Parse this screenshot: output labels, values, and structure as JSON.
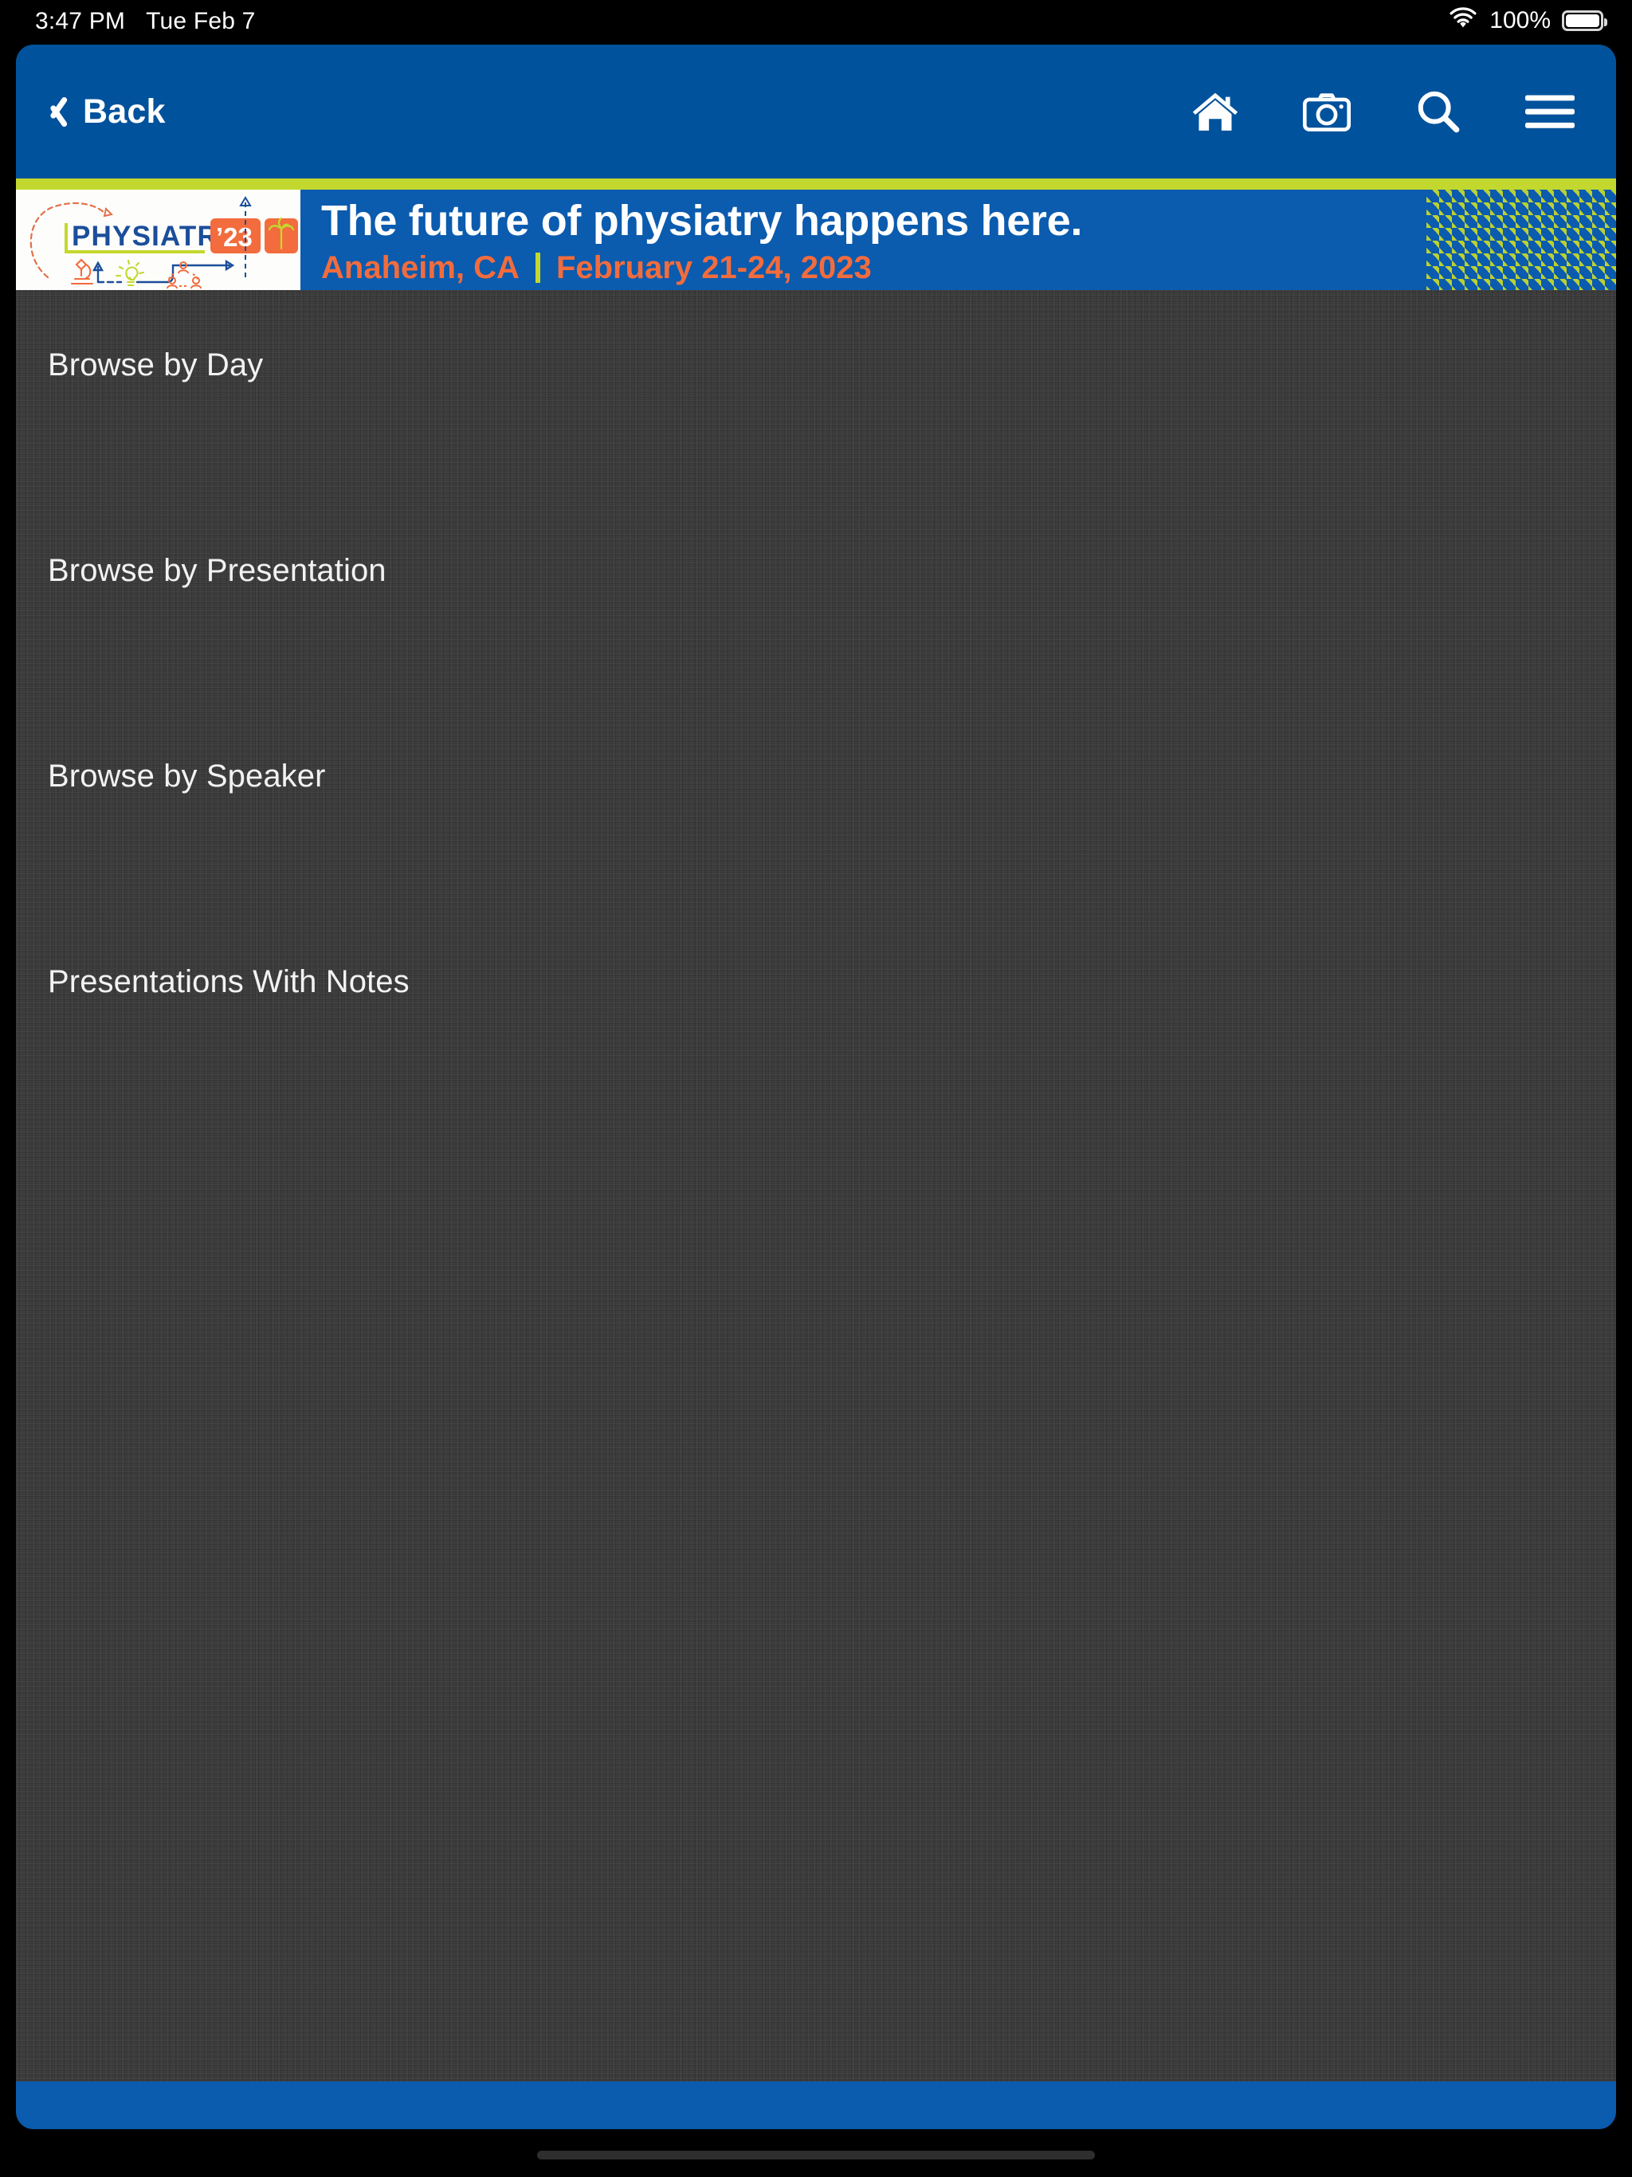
{
  "status_bar": {
    "time": "3:47 PM",
    "date": "Tue Feb 7",
    "battery_percent": "100%",
    "wifi_icon": "wifi-icon",
    "battery_icon": "battery-full-icon"
  },
  "nav_bar": {
    "back_label": "Back",
    "back_icon": "chevron-left-icon",
    "background_color": "#00529C",
    "icons": [
      {
        "name": "home-icon",
        "label": "Home"
      },
      {
        "name": "camera-icon",
        "label": "Camera"
      },
      {
        "name": "search-icon",
        "label": "Search"
      },
      {
        "name": "hamburger-menu-icon",
        "label": "Menu"
      }
    ]
  },
  "banner": {
    "accent_rule_color": "#C3D82E",
    "background_color": "#0B5BAE",
    "headline": "The future of physiatry happens here.",
    "city": "Anaheim, CA",
    "separator": "|",
    "dates": "February 21-24, 2023",
    "city_color": "#F26C3D",
    "logo": {
      "wordmark": "PHYSIATRY",
      "year_badge": "’23",
      "badge_color": "#F26C3D",
      "wordmark_color": "#1B4E9B",
      "icons": [
        "dashed-arc-arrow-icon",
        "microscope-icon",
        "lightbulb-icon",
        "people-network-icon",
        "palm-tree-icon",
        "arrow-up-icon",
        "arrow-right-icon"
      ]
    }
  },
  "menu": {
    "items": [
      {
        "label": "Browse by Day",
        "name": "menu-item-browse-by-day"
      },
      {
        "label": "Browse by Presentation",
        "name": "menu-item-browse-by-presentation"
      },
      {
        "label": "Browse by Speaker",
        "name": "menu-item-browse-by-speaker"
      },
      {
        "label": "Presentations With Notes",
        "name": "menu-item-presentations-with-notes"
      }
    ]
  },
  "bottom_bar": {
    "background_color": "#0B5BAE"
  }
}
